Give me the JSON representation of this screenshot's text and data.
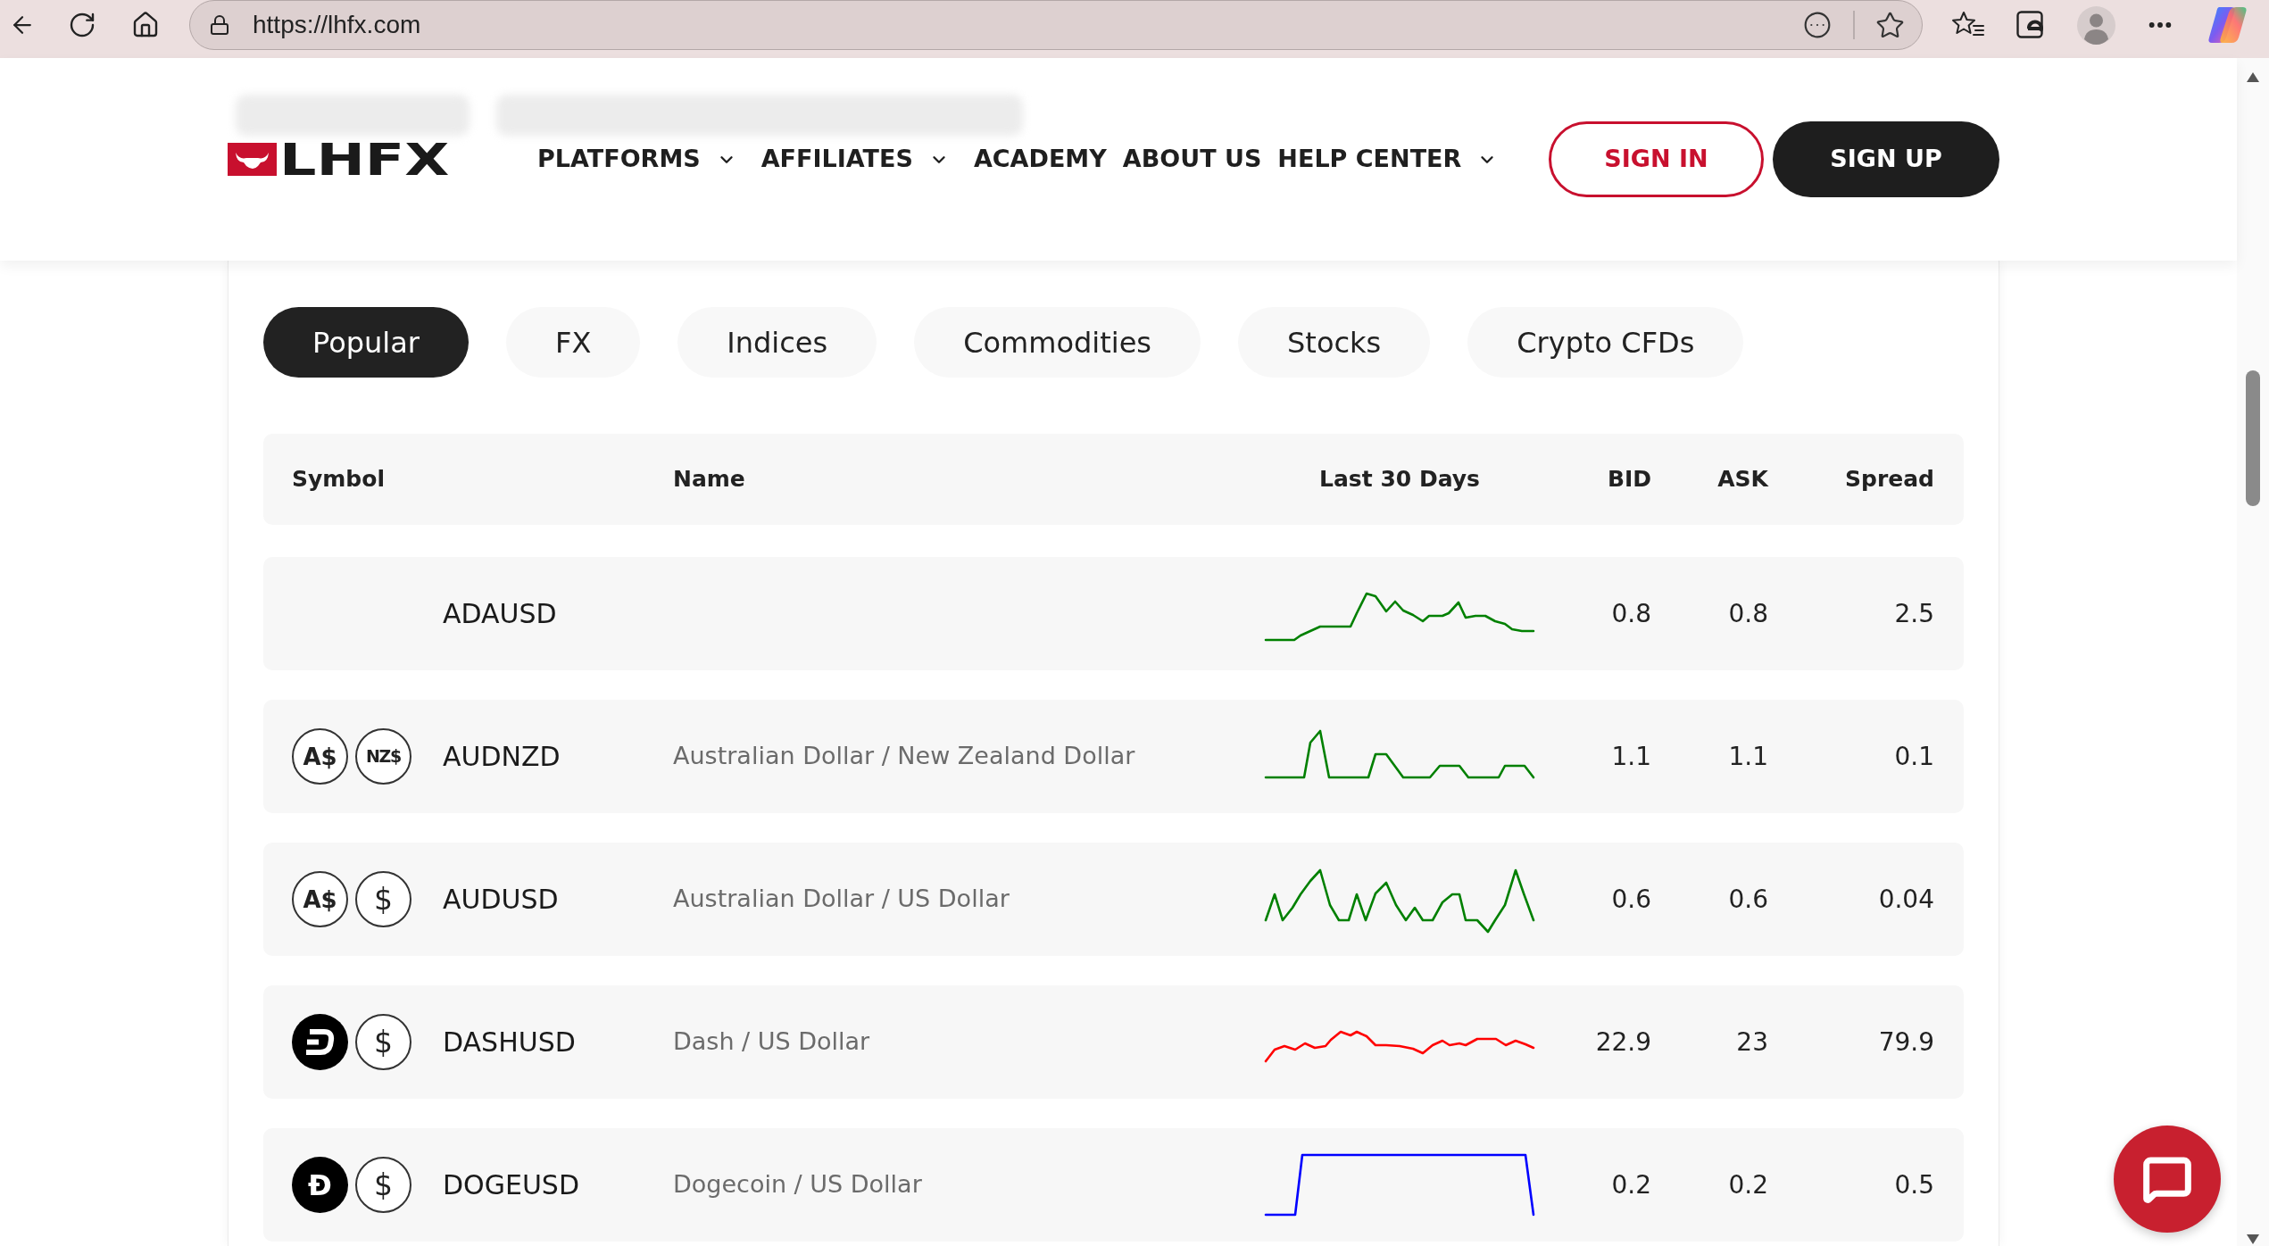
{
  "browser": {
    "url": "https://lhfx.com"
  },
  "header": {
    "logo": "LHFX",
    "nav": [
      {
        "label": "PLATFORMS",
        "dropdown": true
      },
      {
        "label": "AFFILIATES",
        "dropdown": true
      },
      {
        "label": "ACADEMY",
        "dropdown": false
      },
      {
        "label": "ABOUT US",
        "dropdown": false
      },
      {
        "label": "HELP CENTER",
        "dropdown": true
      }
    ],
    "sign_in": "SIGN IN",
    "sign_up": "SIGN UP"
  },
  "tabs": [
    {
      "label": "Popular",
      "selected": true
    },
    {
      "label": "FX",
      "selected": false
    },
    {
      "label": "Indices",
      "selected": false
    },
    {
      "label": "Commodities",
      "selected": false
    },
    {
      "label": "Stocks",
      "selected": false
    },
    {
      "label": "Crypto CFDs",
      "selected": false
    }
  ],
  "table": {
    "columns": [
      "Symbol",
      "Name",
      "Last 30 Days",
      "BID",
      "ASK",
      "Spread"
    ],
    "rows": [
      {
        "symbol": "ADAUSD",
        "color": "#008000",
        "bid": "0.8",
        "ask": "0.8",
        "spread": "2.5"
      },
      {
        "icons": [
          {
            "kind": "outline",
            "glyph": "A$"
          },
          {
            "kind": "outline",
            "glyph": "NZ$"
          }
        ],
        "symbol": "AUDNZD",
        "name": "Australian Dollar / New Zealand Dollar",
        "color": "#008000",
        "bid": "1.1",
        "ask": "1.1",
        "spread": "0.1"
      },
      {
        "icons": [
          {
            "kind": "outline",
            "glyph": "A$"
          },
          {
            "kind": "outline",
            "glyph": "$"
          }
        ],
        "symbol": "AUDUSD",
        "name": "Australian Dollar / US Dollar",
        "color": "#008000",
        "bid": "0.6",
        "ask": "0.6",
        "spread": "0.04"
      },
      {
        "icons": [
          {
            "kind": "dash"
          },
          {
            "kind": "outline",
            "glyph": "$"
          }
        ],
        "symbol": "DASHUSD",
        "name": "Dash / US Dollar",
        "color": "#ff0000",
        "bid": "22.9",
        "ask": "23",
        "spread": "79.9"
      },
      {
        "icons": [
          {
            "kind": "solid",
            "glyph": "Ð"
          },
          {
            "kind": "outline",
            "glyph": "$"
          }
        ],
        "symbol": "DOGEUSD",
        "name": "Dogecoin / US Dollar",
        "color": "#0000ff",
        "bid": "0.2",
        "ask": "0.2",
        "spread": "0.5"
      }
    ]
  }
}
